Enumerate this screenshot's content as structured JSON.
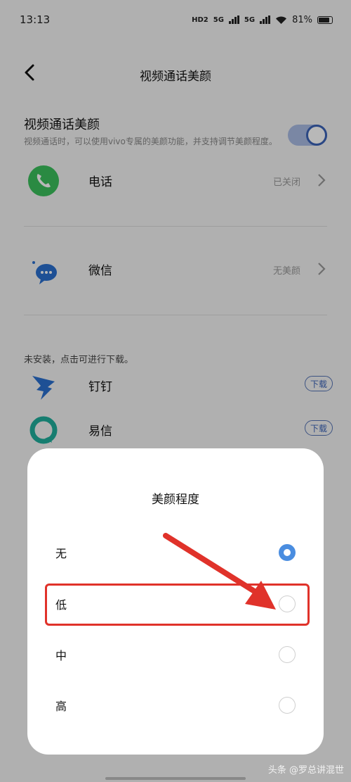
{
  "status_bar": {
    "time": "13:13",
    "hd": "HD2",
    "sig1": "5G",
    "sig2": "5G",
    "battery": "81%"
  },
  "nav": {
    "title": "视频通话美颜"
  },
  "setting": {
    "title": "视频通话美颜",
    "desc": "视频通话时，可以使用vivo专属的美颜功能，并支持调节美颜程度。",
    "enabled": true
  },
  "apps": [
    {
      "name": "电话",
      "status": "已关闭"
    },
    {
      "name": "微信",
      "status": "无美颜"
    }
  ],
  "not_installed": {
    "label": "未安装，点击可进行下载。",
    "apps": [
      {
        "name": "钉钉",
        "button": "下载"
      },
      {
        "name": "易信",
        "button": "下载"
      }
    ]
  },
  "dialog": {
    "title": "美颜程度",
    "options": [
      {
        "label": "无",
        "selected": true
      },
      {
        "label": "低",
        "selected": false
      },
      {
        "label": "中",
        "selected": false
      },
      {
        "label": "高",
        "selected": false
      }
    ]
  },
  "watermark": "头条 @罗总讲混世",
  "colors": {
    "accent": "#4a8de0",
    "toggle": "#3b63b8",
    "annotation": "#e0322a"
  }
}
